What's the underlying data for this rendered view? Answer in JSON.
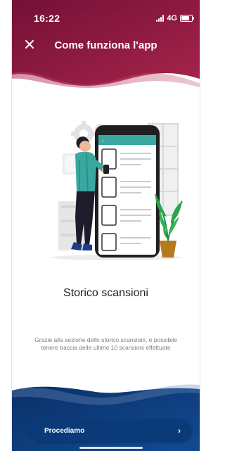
{
  "status_bar": {
    "time": "16:22",
    "network": "4G",
    "battery_level": 0.7
  },
  "header": {
    "title": "Come funziona l'app",
    "close_icon": "close-icon"
  },
  "slide": {
    "title": "Storico scansioni",
    "description": "Grazie alla sezione dello storico scansioni, è possibile tenere traccia delle ultime 10 scansioni effettuate"
  },
  "cta": {
    "label": "Procediamo",
    "chevron": "›"
  },
  "colors": {
    "header_gradient_start": "#7a1036",
    "header_gradient_end": "#a01f45",
    "footer_blue": "#0b3a78",
    "accent_teal": "#3aa7a1",
    "plant_green": "#29a64a"
  }
}
